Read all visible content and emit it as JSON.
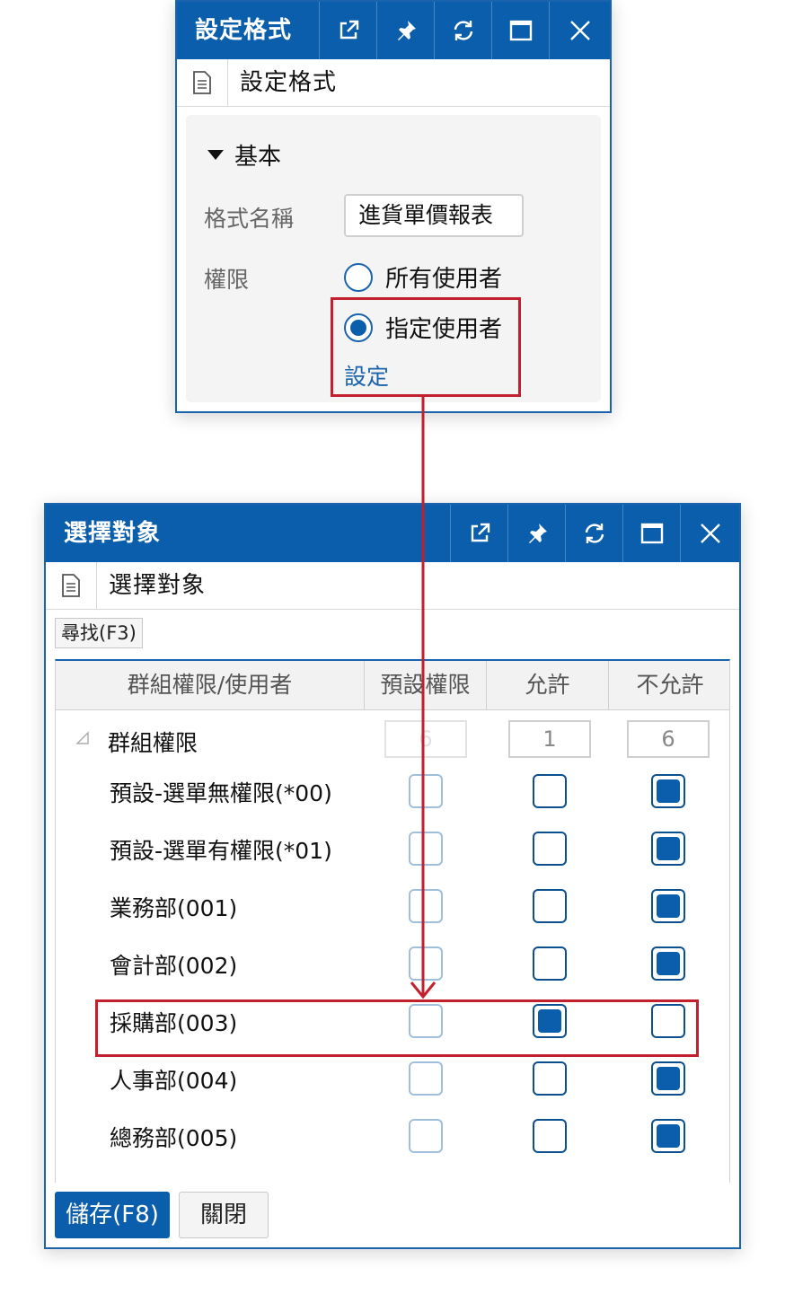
{
  "format_window": {
    "title": "設定格式",
    "subtitle": "設定格式",
    "section": "基本",
    "format_name_label": "格式名稱",
    "format_name_value": "進貨單價報表",
    "permission_label": "權限",
    "radio_all_users": "所有使用者",
    "radio_specified_users": "指定使用者",
    "selected_option": "指定使用者",
    "settings_link": "設定"
  },
  "select_window": {
    "title": "選擇對象",
    "subtitle": "選擇對象",
    "find_button": "尋找(F3)",
    "columns": [
      "群組權限/使用者",
      "預設權限",
      "允許",
      "不允許"
    ],
    "group_label": "群組權限",
    "group_counts": {
      "default": "6",
      "allow": "1",
      "deny": "6"
    },
    "rows": [
      {
        "label": "預設-選單無權限(*00)",
        "default": false,
        "allow": false,
        "deny": true
      },
      {
        "label": "預設-選單有權限(*01)",
        "default": false,
        "allow": false,
        "deny": true
      },
      {
        "label": "業務部(001)",
        "default": false,
        "allow": false,
        "deny": true
      },
      {
        "label": "會計部(002)",
        "default": false,
        "allow": false,
        "deny": true
      },
      {
        "label": "採購部(003)",
        "default": false,
        "allow": true,
        "deny": false
      },
      {
        "label": "人事部(004)",
        "default": false,
        "allow": false,
        "deny": true
      },
      {
        "label": "總務部(005)",
        "default": false,
        "allow": false,
        "deny": true
      }
    ],
    "save_button": "儲存(F8)",
    "close_button": "關閉"
  },
  "colors": {
    "accent": "#0b5eab",
    "highlight": "#c2202e"
  },
  "title_icons": [
    "external-link-icon",
    "pin-icon",
    "refresh-icon",
    "maximize-icon",
    "close-icon"
  ]
}
